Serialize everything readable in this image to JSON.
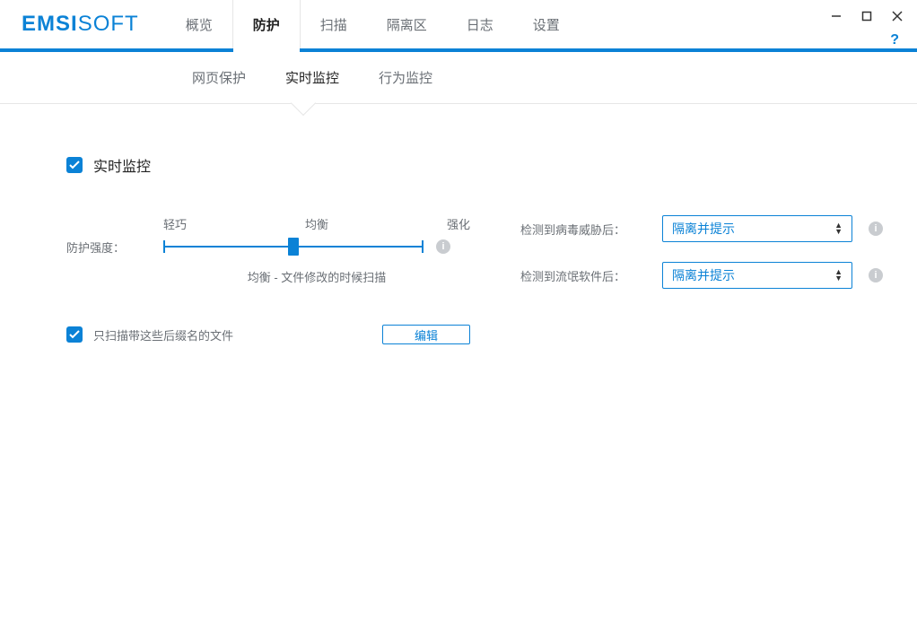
{
  "window": {
    "minimize": "—",
    "maximize": "▢",
    "close": "✕",
    "help": "?"
  },
  "brand": {
    "bold": "EMSI",
    "thin": "SOFT"
  },
  "nav": {
    "items": [
      "概览",
      "防护",
      "扫描",
      "隔离区",
      "日志",
      "设置"
    ],
    "active": 1
  },
  "subnav": {
    "items": [
      "网页保护",
      "实时监控",
      "行为监控"
    ],
    "active": 1
  },
  "section": {
    "title": "实时监控"
  },
  "slider": {
    "label": "防护强度：",
    "ticks": [
      "轻巧",
      "均衡",
      "强化"
    ],
    "desc": "均衡 - 文件修改的时候扫描"
  },
  "dropdowns": [
    {
      "label": "检测到病毒威胁后：",
      "value": "隔离并提示"
    },
    {
      "label": "检测到流氓软件后：",
      "value": "隔离并提示"
    }
  ],
  "scanExt": {
    "label": "只扫描带这些后缀名的文件",
    "edit": "编辑"
  }
}
